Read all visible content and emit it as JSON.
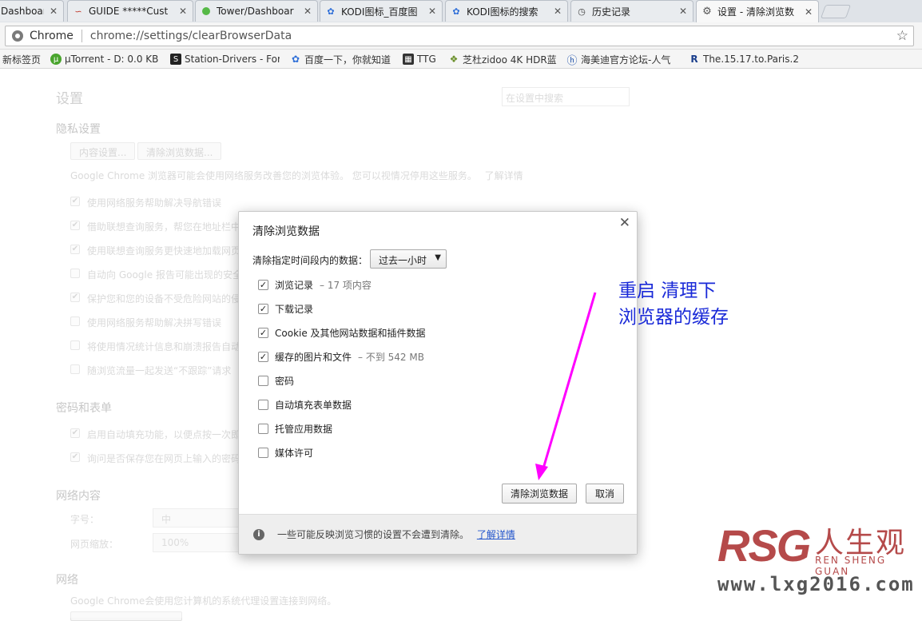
{
  "tabs": [
    {
      "title": "Dashboar",
      "icon": "page-icon"
    },
    {
      "title": "GUIDE *****Cust",
      "icon": "guide-icon"
    },
    {
      "title": "Tower/Dashboar",
      "icon": "tower-icon"
    },
    {
      "title": "KODI图标_百度图",
      "icon": "paw-icon"
    },
    {
      "title": "KODI图标的搜索",
      "icon": "paw-icon"
    },
    {
      "title": "历史记录",
      "icon": "history-icon"
    },
    {
      "title": "设置 - 清除浏览数",
      "icon": "gear-icon",
      "active": true
    }
  ],
  "omnibox": {
    "scheme": "Chrome",
    "url": "chrome://settings/clearBrowserData"
  },
  "bookmarks": [
    {
      "label": "新标签页",
      "icon": "none"
    },
    {
      "label": "µTorrent - D: 0.0 KB",
      "icon": "utorrent-icon"
    },
    {
      "label": "Station-Drivers - For",
      "icon": "station-drivers-icon"
    },
    {
      "label": "百度一下，你就知道",
      "icon": "paw-icon"
    },
    {
      "label": "TTG",
      "icon": "ttg-icon"
    },
    {
      "label": "芝杜zidoo 4K HDR蓝",
      "icon": "zidoo-icon"
    },
    {
      "label": "海美迪官方论坛-人气",
      "icon": "himedia-icon"
    },
    {
      "label": "The.15.17.to.Paris.20",
      "icon": "r-icon"
    }
  ],
  "settings": {
    "title": "设置",
    "search_placeholder": "在设置中搜索",
    "privacy_heading": "隐私设置",
    "content_settings_btn": "内容设置...",
    "clear_data_btn": "清除浏览数据...",
    "privacy_desc": "Google Chrome 浏览器可能会使用网络服务改善您的浏览体验。 您可以视情况停用这些服务。",
    "learn_more": "了解详情",
    "privacy_items": [
      {
        "label": "使用网络服务帮助解决导航错误",
        "checked": true
      },
      {
        "label": "借助联想查询服务，帮您在地址栏中",
        "checked": true
      },
      {
        "label": "使用联想查询服务更快速地加载网页",
        "checked": true
      },
      {
        "label": "自动向 Google 报告可能出现的安全",
        "checked": false
      },
      {
        "label": "保护您和您的设备不受危险网站的侵",
        "checked": true
      },
      {
        "label": "使用网络服务帮助解决拼写错误",
        "checked": false
      },
      {
        "label": "将使用情况统计信息和崩溃报告自动",
        "checked": false
      },
      {
        "label": "随浏览流量一起发送“不跟踪”请求",
        "checked": false
      }
    ],
    "password_heading": "密码和表单",
    "password_items": [
      {
        "label": "启用自动填充功能，以便点按一次即",
        "checked": true
      },
      {
        "label": "询问是否保存您在网页上输入的密码",
        "checked": true
      }
    ],
    "web_content_heading": "网络内容",
    "font_size_label": "字号：",
    "font_size_value": "中",
    "zoom_label": "网页缩放：",
    "zoom_value": "100%",
    "network_heading": "网络",
    "network_desc": "Google Chrome会使用您计算机的系统代理设置连接到网络。"
  },
  "dialog": {
    "title": "清除浏览数据",
    "range_label": "清除指定时间段内的数据：",
    "range_value": "过去一小时",
    "options": [
      {
        "label": "浏览记录",
        "detail": "– 17 项内容",
        "checked": true
      },
      {
        "label": "下载记录",
        "detail": "",
        "checked": true
      },
      {
        "label": "Cookie 及其他网站数据和插件数据",
        "detail": "",
        "checked": true
      },
      {
        "label": "缓存的图片和文件",
        "detail": "– 不到 542 MB",
        "checked": true
      },
      {
        "label": "密码",
        "detail": "",
        "checked": false
      },
      {
        "label": "自动填充表单数据",
        "detail": "",
        "checked": false
      },
      {
        "label": "托管应用数据",
        "detail": "",
        "checked": false
      },
      {
        "label": "媒体许可",
        "detail": "",
        "checked": false
      }
    ],
    "clear_button": "清除浏览数据",
    "cancel_button": "取消",
    "footer_text": "一些可能反映浏览习惯的设置不会遭到清除。",
    "footer_link": "了解详情"
  },
  "annotation": {
    "line1": "重启 清理下",
    "line2": "浏览器的缓存",
    "color": "#1a2ad8",
    "arrow_color": "#ff00ff"
  },
  "watermark": {
    "logo": "RSG",
    "cn": "人生观",
    "pinyin": "REN SHENG GUAN",
    "url": "www.lxg2016.com"
  }
}
